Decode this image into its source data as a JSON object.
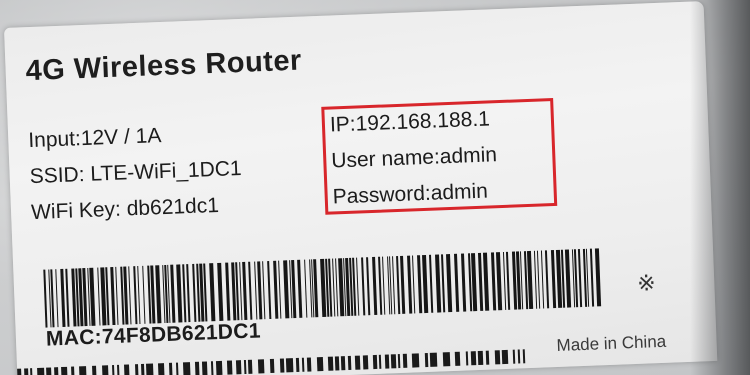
{
  "label": {
    "title": "4G Wireless Router",
    "input": "Input:12V / 1A",
    "ssid": "SSID: LTE-WiFi_1DC1",
    "wifi_key": "WiFi Key:  db621dc1",
    "ip": "IP:192.168.188.1",
    "user_name": "User name:admin",
    "password": "Password:admin",
    "mac": "MAC:74F8DB621DC1",
    "made_in": "Made in China",
    "symbol": "※"
  },
  "colors": {
    "highlight_box": "#d8262b",
    "label_paper": "#efefef",
    "ink": "#1c1c1c"
  }
}
